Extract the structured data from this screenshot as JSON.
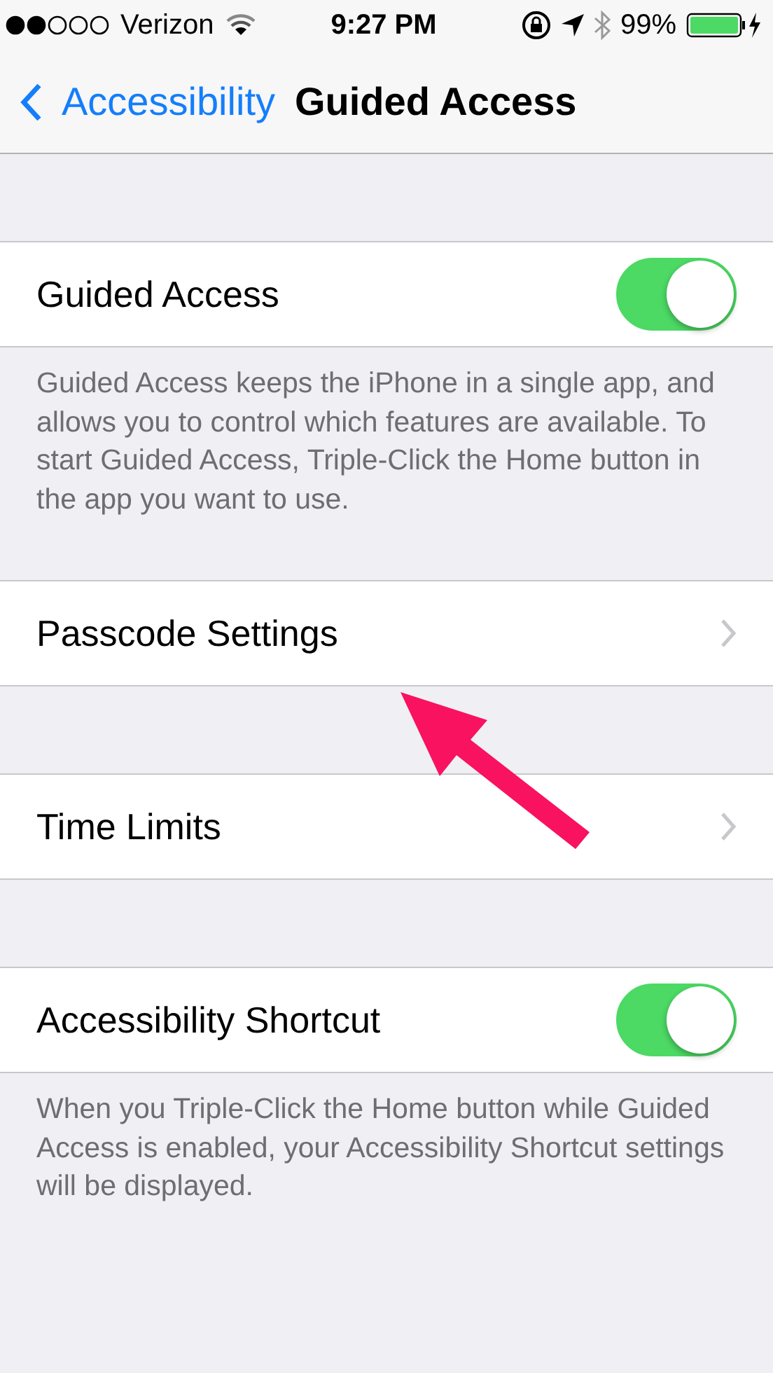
{
  "status_bar": {
    "carrier": "Verizon",
    "time": "9:27 PM",
    "battery": "99%"
  },
  "nav": {
    "back": "Accessibility",
    "title": "Guided Access"
  },
  "groups": [
    {
      "rows": [
        {
          "label": "Guided Access",
          "kind": "toggle",
          "on": true
        }
      ],
      "footer": "Guided Access keeps the iPhone in a single app, and allows you to control which features are available. To start Guided Access, Triple-Click the Home button in the app you want to use."
    },
    {
      "rows": [
        {
          "label": "Passcode Settings",
          "kind": "link"
        }
      ]
    },
    {
      "rows": [
        {
          "label": "Time Limits",
          "kind": "link"
        }
      ]
    },
    {
      "rows": [
        {
          "label": "Accessibility Shortcut",
          "kind": "toggle",
          "on": true
        }
      ],
      "footer": "When you Triple-Click the Home button while Guided Access is enabled, your Accessibility Shortcut settings will be displayed."
    }
  ]
}
